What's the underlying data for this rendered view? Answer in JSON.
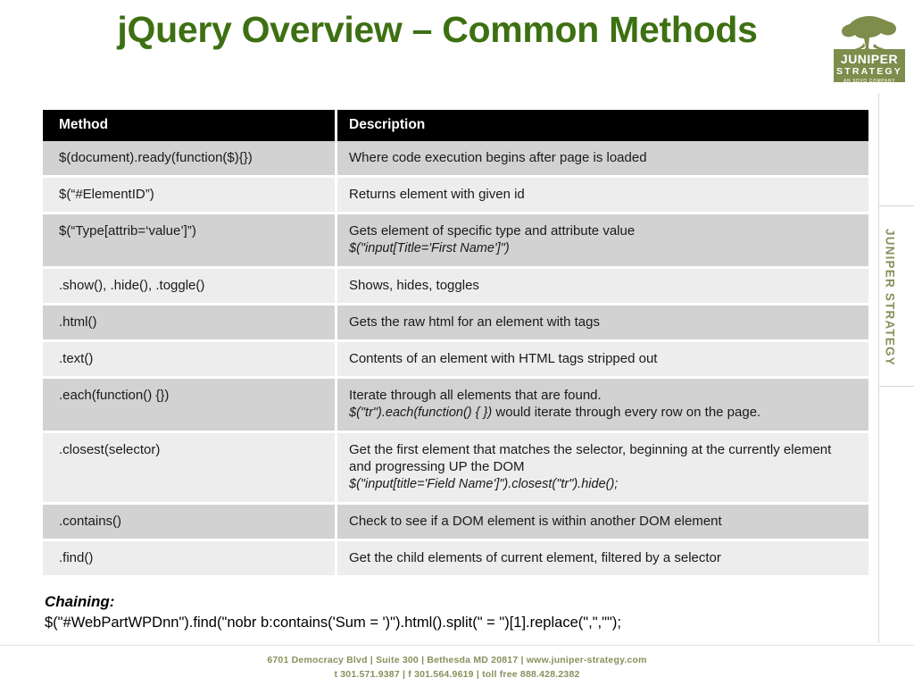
{
  "slide": {
    "title": "jQuery Overview – Common Methods",
    "title_color": "#3d7012"
  },
  "logo": {
    "name": "juniper-strategy-logo",
    "line1": "JUNIPER",
    "line2": "STRATEGY",
    "line3": "AN SDVO COMPANY",
    "color": "#7e8c4c"
  },
  "right_rail": {
    "vertical_text": "JUNIPER STRATEGY"
  },
  "table": {
    "headers": [
      "Method",
      "Description"
    ],
    "rows": [
      {
        "method": "$(document).ready(function($){})",
        "desc": "Where code execution begins after page is loaded",
        "desc_code": ""
      },
      {
        "method": "$(“#ElementID”)",
        "desc": "Returns element with given id",
        "desc_code": ""
      },
      {
        "method": "$(“Type[attrib=‘value’]”)",
        "desc": "Gets element of specific type and attribute value",
        "desc_code": "$(\"input[Title='First Name']\")"
      },
      {
        "method": ".show(), .hide(), .toggle()",
        "desc": "Shows, hides, toggles",
        "desc_code": ""
      },
      {
        "method": ".html()",
        "desc": "Gets the raw html for an element with tags",
        "desc_code": ""
      },
      {
        "method": ".text()",
        "desc": "Contents of an element with HTML tags stripped out",
        "desc_code": ""
      },
      {
        "method": ".each(function() {})",
        "desc": "Iterate through all elements that are found.",
        "desc_code": "$(\"tr\").each(function() { })",
        "desc_tail": " would iterate through every row on the page."
      },
      {
        "method": ".closest(selector)",
        "desc": "Get the first element that matches the selector, beginning at the currently element and progressing UP the DOM",
        "desc_code": "$(\"input[title='Field Name']\").closest(\"tr\").hide();"
      },
      {
        "method": ".contains()",
        "desc": "Check to see if a DOM element is within another DOM element",
        "desc_code": ""
      },
      {
        "method": ".find()",
        "desc": "Get the child elements of current element, filtered by a selector",
        "desc_code": ""
      }
    ]
  },
  "chaining": {
    "label": "Chaining:",
    "code": "$(\"#WebPartWPDnn\").find(\"nobr b:contains('Sum = ')\").html().split(\" = \")[1].replace(\",\",\"\");"
  },
  "footer": {
    "line1": "6701 Democracy Blvd | Suite 300 | Bethesda MD 20817 | www.juniper-strategy.com",
    "line2": "t 301.571.9387 | f 301.564.9619 | toll free 888.428.2382"
  }
}
